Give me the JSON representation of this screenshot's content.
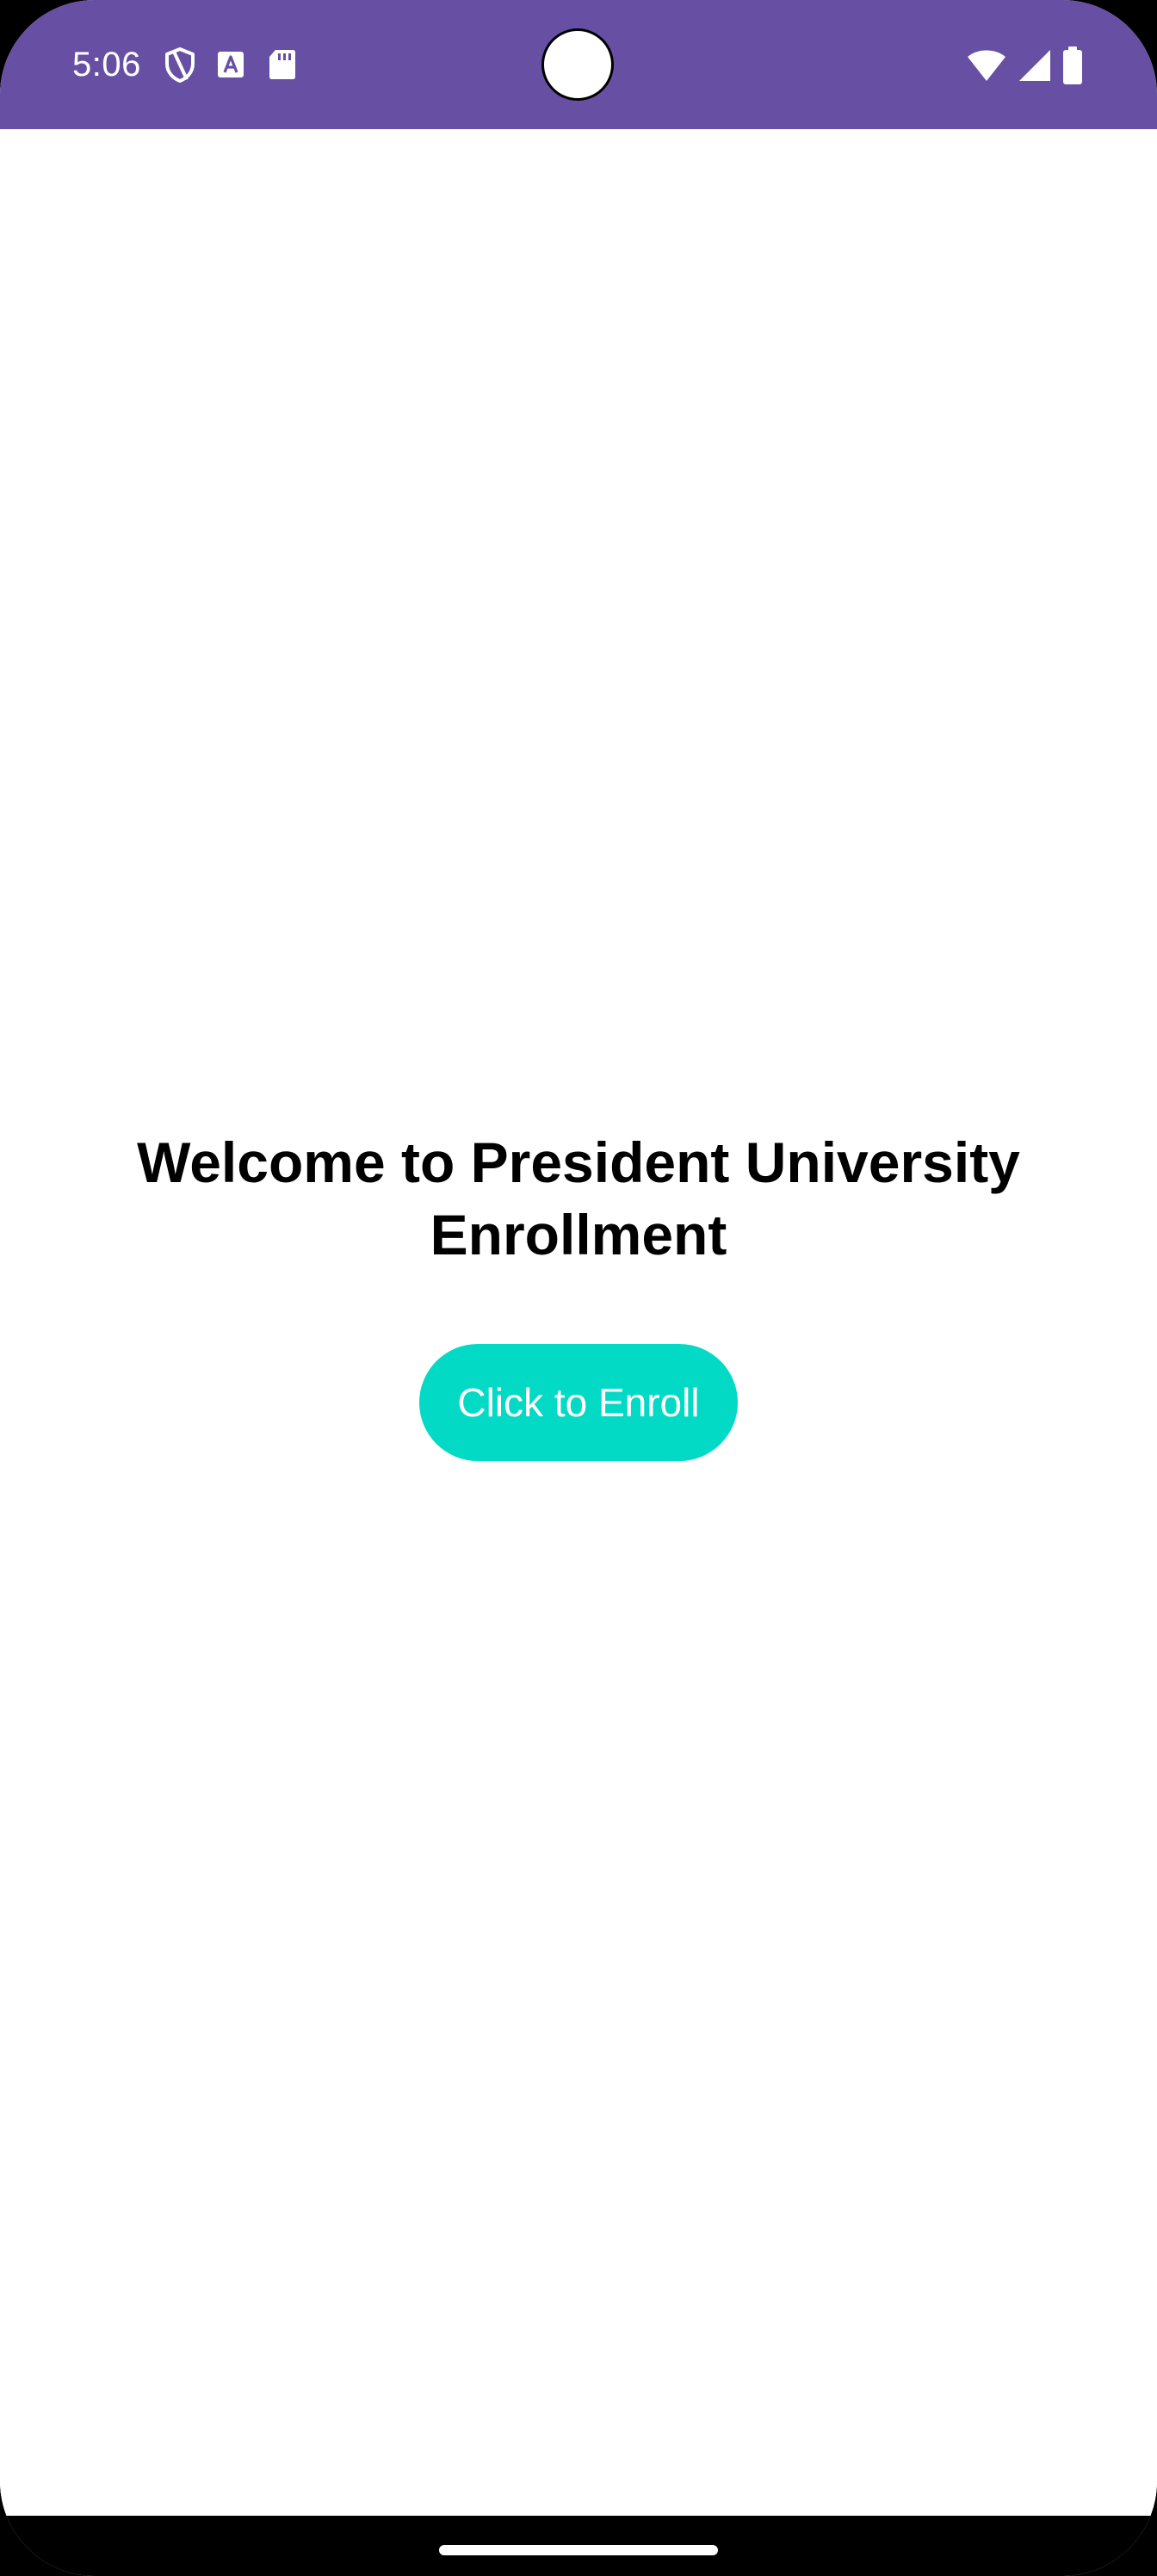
{
  "status_bar": {
    "time": "5:06",
    "color": "#6750a4",
    "left_icons": [
      "vpn-shield-icon",
      "text-a-notification-icon",
      "sd-card-icon"
    ],
    "right_icons": [
      "wifi-icon",
      "cellular-signal-icon",
      "battery-icon"
    ]
  },
  "main": {
    "title": "Welcome to President University Enrollment",
    "enroll_button_label": "Click to Enroll",
    "button_color": "#03dac5",
    "background": "#ffffff"
  },
  "nav_bar": {
    "color": "#000000",
    "home_indicator": "home-gesture-handle"
  }
}
